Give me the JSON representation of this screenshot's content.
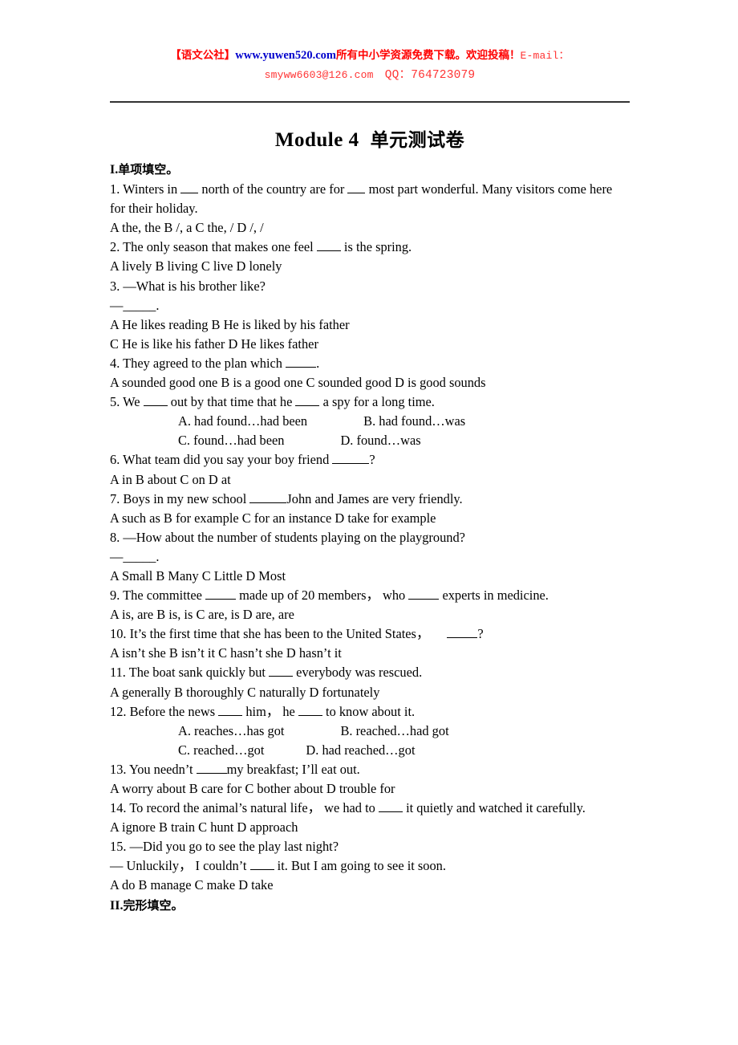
{
  "banner": {
    "bracket_cn": "【语文公社】",
    "url": "www.yuwen520.com",
    "tail_cn": "所有中小学资源免费下载。欢迎投稿！",
    "email_label": "E-mail：",
    "email": "smyww6603@126.com",
    "qq_label": "QQ：",
    "qq": "764723079",
    "colors": {
      "red": "#ff0000",
      "blue": "#0000cc",
      "light_red": "#ff3333"
    }
  },
  "title": {
    "en": "Module 4",
    "cn": "单元测试卷"
  },
  "sections": {
    "s1_label": "I.",
    "s1_cn": "单项填空。",
    "s2_label": "II.",
    "s2_cn": "完形填空。"
  },
  "questions": [
    {
      "num": "1.",
      "stem_a": "Winters in",
      "stem_b": "north of the country are for",
      "stem_c": "most part wonderful. Many visitors come here for their holiday.",
      "options_line": "A the,   the     B /,   a     C the,   /     D /,   /"
    },
    {
      "num": "2.",
      "stem_a": "The only season that makes one feel",
      "stem_b": "is the spring.",
      "options_line": "A lively     B living   C live     D lonely"
    },
    {
      "num": "3.",
      "stem_a": "—What is his brother like?",
      "answer_line": "—_____.",
      "options_line_1": "A He likes reading         B He is liked by his father",
      "options_line_2": "C He is like his father       D He likes father"
    },
    {
      "num": "4.",
      "stem_a": "They agreed to the plan which",
      "stem_b": ".",
      "options_line": "A sounded good one         B is a good one     C sounded good          D is good sounds"
    },
    {
      "num": "5.",
      "stem_a": "We",
      "stem_b": "out by that time that he",
      "stem_c": "a spy for a long time.",
      "options_row_1a": "A. had found…had been",
      "options_row_1b": "B. had found…was",
      "options_row_2a": "C. found…had been",
      "options_row_2b": "D. found…was"
    },
    {
      "num": "6.",
      "stem_a": "What team did you say your boy friend",
      "stem_b": "?",
      "options_line": "A in          B about      C on         D at"
    },
    {
      "num": "7.",
      "stem_a": "Boys in my new school",
      "stem_b": "John and James are very friendly.",
      "options_line": "A such as       B for example       C for an instance      D take for example"
    },
    {
      "num": "8.",
      "stem_a": "—How about the number of students playing on the playground?",
      "answer_line": "—_____.",
      "options_line": "A Small    B Many    C Little    D Most"
    },
    {
      "num": "9.",
      "stem_a": "The committee",
      "stem_b": "made up of 20 members，  who",
      "stem_c": "experts in medicine.",
      "options_line": "A is,   are    B is,   is    C are,   is    D are,   are"
    },
    {
      "num": "10.",
      "stem_a": "It’s the first time that she has been to the United States，",
      "stem_b": "?",
      "options_line": "A isn’t she      B isn’t it    C hasn’t she       D hasn’t it"
    },
    {
      "num": "11.",
      "stem_a": "The boat sank quickly but",
      "stem_b": "everybody was rescued.",
      "options_line": "A generally    B thoroughly    C naturally    D fortunately"
    },
    {
      "num": "12.",
      "stem_a": "Before the news",
      "stem_b": "him，  he",
      "stem_c": "to know about it.",
      "options_row_1a": "A. reaches…has got",
      "options_row_1b": "B. reached…had got",
      "options_row_2a": "C. reached…got",
      "options_row_2b": "D. had reached…got"
    },
    {
      "num": "13.",
      "stem_a": "You needn’t",
      "stem_b": "my breakfast; I’ll eat out.",
      "options_line": "A worry about   B care for     C bother about     D trouble for"
    },
    {
      "num": "14.",
      "stem_a": "To record the animal’s natural life，  we had to",
      "stem_b": "it quietly and watched it carefully.",
      "options_line": "A ignore    B train    C hunt    D approach"
    },
    {
      "num": "15.",
      "stem_a": "—Did you go to see the play last night?",
      "answer_a": "— Unluckily，  I couldn’t",
      "answer_b": "it. But I am going to see it soon.",
      "options_line": "A do     B manage     C make     D take"
    }
  ]
}
